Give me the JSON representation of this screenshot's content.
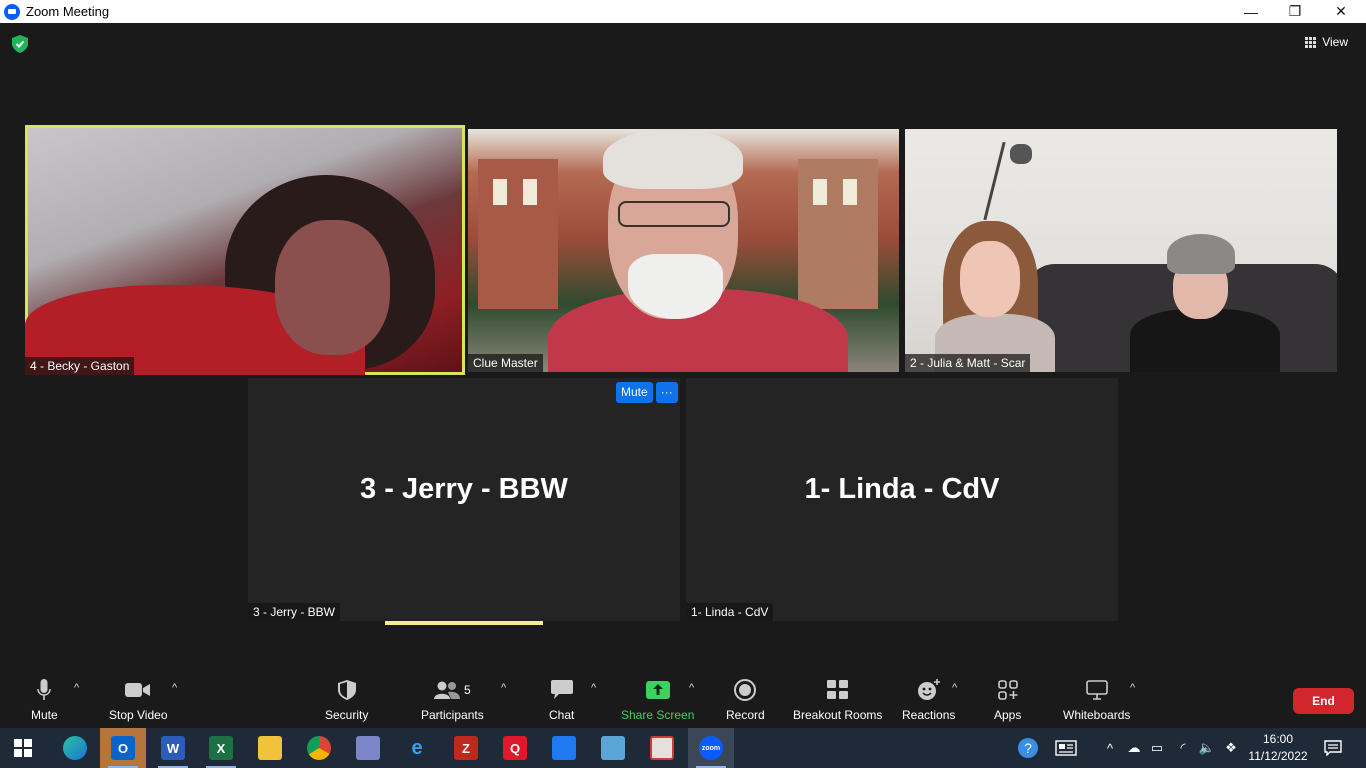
{
  "window": {
    "title": "Zoom Meeting",
    "minimize": "—",
    "restore": "❐",
    "close": "✕"
  },
  "header": {
    "view_label": "View"
  },
  "participants": {
    "becky": "4 - Becky - Gaston",
    "clue": "Clue Master",
    "julia": "2 - Julia & Matt - Scar",
    "jerry": "3 - Jerry - BBW",
    "linda": "1- Linda - CdV"
  },
  "tile_popup": {
    "mute_label": "Mute",
    "more_label": "···"
  },
  "toolbar": {
    "mute": "Mute",
    "stop_video": "Stop Video",
    "security": "Security",
    "participants": "Participants",
    "participants_count": "5",
    "chat": "Chat",
    "share_screen": "Share Screen",
    "record": "Record",
    "breakout_rooms": "Breakout Rooms",
    "reactions": "Reactions",
    "apps": "Apps",
    "whiteboards": "Whiteboards",
    "end": "End",
    "caret": "^",
    "accent_share": "#3dd15e",
    "accent_end": "#d0262c"
  },
  "taskbar": {
    "apps": [
      "start-icon",
      "edge-icon",
      "outlook-icon",
      "word-icon",
      "excel-icon",
      "file-explorer-icon",
      "chrome-icon",
      "app-icon",
      "internet-explorer-icon",
      "filezilla-icon",
      "quickbooks-icon",
      "dropbox-icon",
      "control-panel-icon",
      "pdf-icon",
      "zoom-icon"
    ],
    "time": "16:00",
    "date": "11/12/2022"
  }
}
